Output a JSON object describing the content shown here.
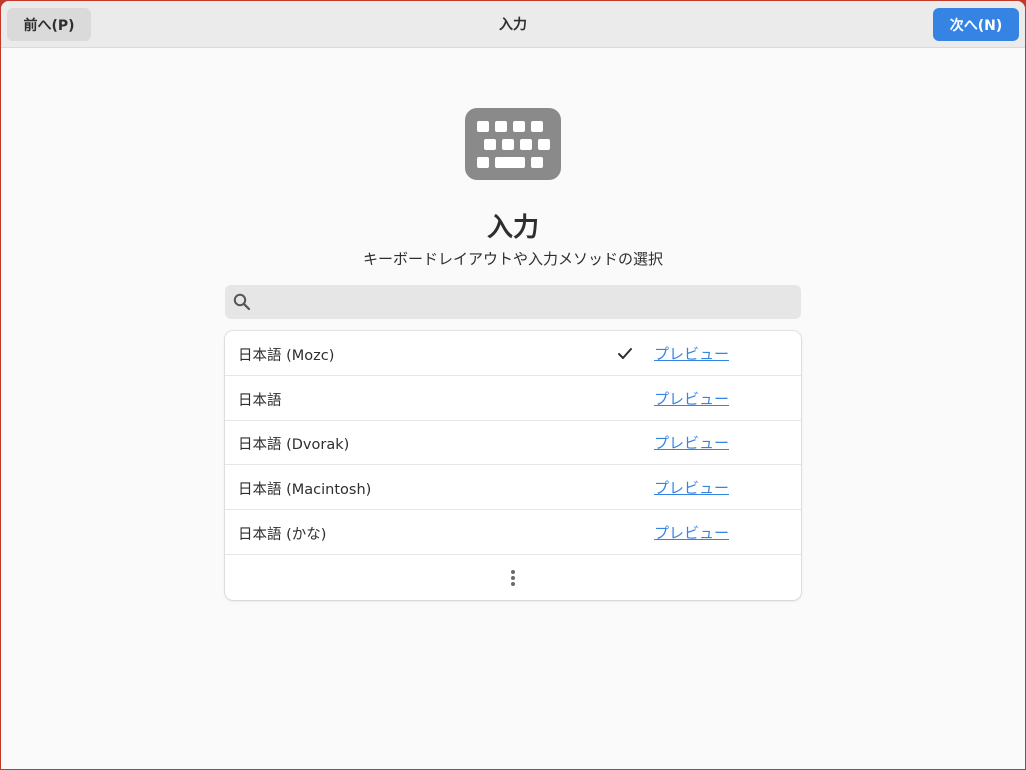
{
  "header": {
    "prev_label": "前へ(P)",
    "title": "入力",
    "next_label": "次へ(N)"
  },
  "page": {
    "title": "入力",
    "subtitle": "キーボードレイアウトや入力メソッドの選択",
    "icon": "keyboard-icon"
  },
  "search": {
    "placeholder": "",
    "value": "",
    "icon": "search-icon"
  },
  "inputs": [
    {
      "label": "日本語 (Mozc)",
      "selected": true,
      "preview": "プレビュー"
    },
    {
      "label": "日本語",
      "selected": false,
      "preview": "プレビュー"
    },
    {
      "label": "日本語 (Dvorak)",
      "selected": false,
      "preview": "プレビュー"
    },
    {
      "label": "日本語 (Macintosh)",
      "selected": false,
      "preview": "プレビュー"
    },
    {
      "label": "日本語 (かな)",
      "selected": false,
      "preview": "プレビュー"
    }
  ],
  "more_icon": "more-vertical-icon",
  "colors": {
    "accent": "#3584e4",
    "icon_gray": "#8a8a8a",
    "text": "#2e2e2e"
  }
}
